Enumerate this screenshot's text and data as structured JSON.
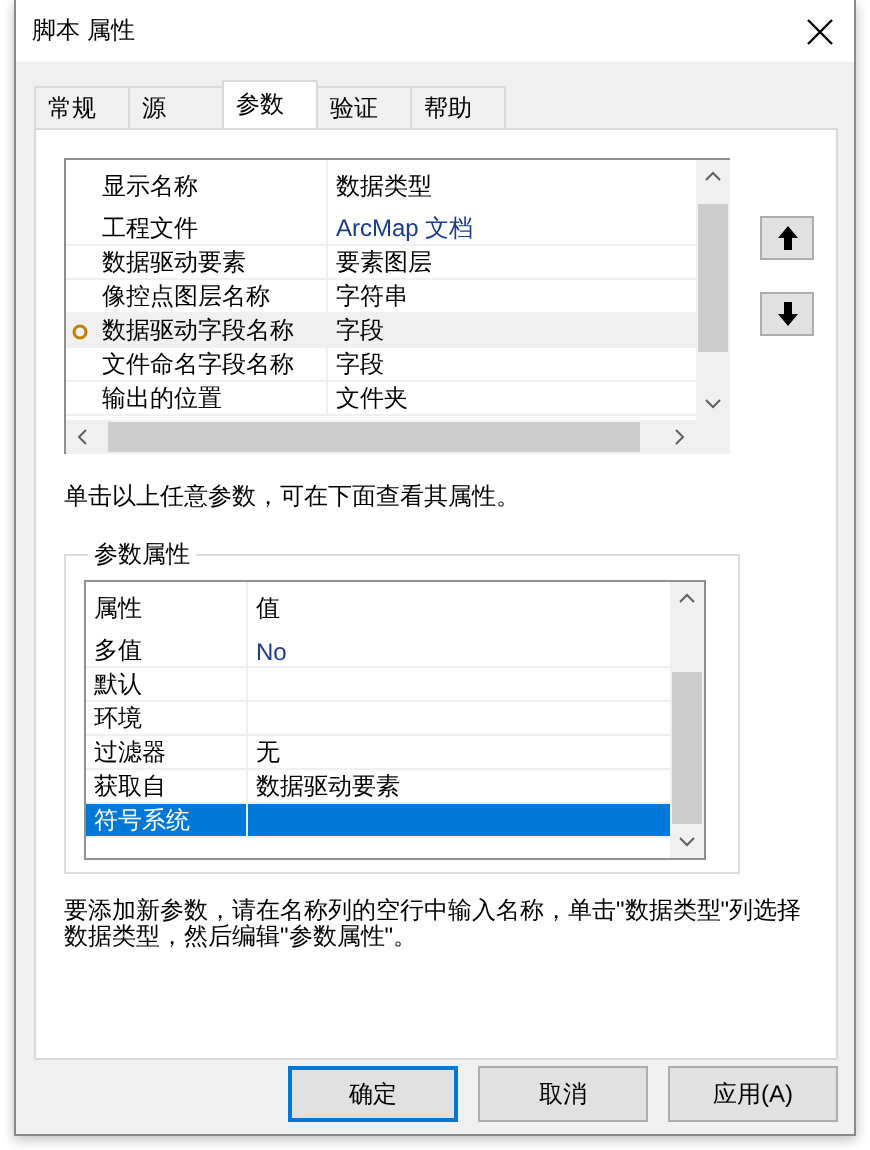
{
  "window": {
    "title": "脚本 属性"
  },
  "tabs": [
    {
      "label": "常规",
      "selected": false
    },
    {
      "label": "源",
      "selected": false
    },
    {
      "label": "参数",
      "selected": true
    },
    {
      "label": "验证",
      "selected": false
    },
    {
      "label": "帮助",
      "selected": false
    }
  ],
  "parameters": {
    "columns": [
      "显示名称",
      "数据类型"
    ],
    "rows": [
      {
        "name": "工程文件",
        "type": "ArcMap 文档",
        "selected": false
      },
      {
        "name": "数据驱动要素",
        "type": "要素图层",
        "selected": false
      },
      {
        "name": "像控点图层名称",
        "type": "字符串",
        "selected": false
      },
      {
        "name": "数据驱动字段名称",
        "type": "字段",
        "selected": true
      },
      {
        "name": "文件命名字段名称",
        "type": "字段",
        "selected": false
      },
      {
        "name": "输出的位置",
        "type": "文件夹",
        "selected": false
      }
    ]
  },
  "hint": "单击以上任意参数，可在下面查看其属性。",
  "properties": {
    "title": "参数属性",
    "columns": [
      "属性",
      "值"
    ],
    "rows": [
      {
        "name": "多值",
        "value": "No",
        "selected": false
      },
      {
        "name": "默认",
        "selected": false
      },
      {
        "name": "环境",
        "selected": false
      },
      {
        "name": "过滤器",
        "value": "无",
        "selected": false
      },
      {
        "name": "获取自",
        "value": "数据驱动要素",
        "selected": false
      },
      {
        "name": "符号系统",
        "selected": true
      }
    ]
  },
  "help_text": "要添加新参数，请在名称列的空行中输入名称，单击\"数据类型\"列选择数据类型，然后编辑\"参数属性\"。",
  "buttons": [
    {
      "label": "确定",
      "kind": "default"
    },
    {
      "label": "取消",
      "kind": "normal"
    },
    {
      "label": "应用(A)",
      "kind": "normal"
    }
  ]
}
